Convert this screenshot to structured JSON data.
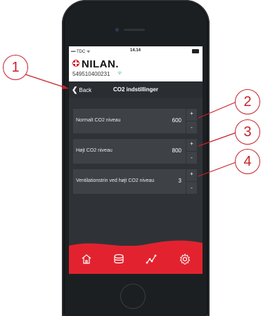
{
  "status_bar": {
    "carrier": "TDC",
    "time": "14.14"
  },
  "brand": {
    "logo_text": "NILAN.",
    "serial": "549510400231"
  },
  "nav": {
    "back_label": "Back",
    "title": "CO2 indstillinger"
  },
  "settings": [
    {
      "label": "Normalt CO2 niveau",
      "value": "600",
      "plus": "+",
      "minus": "-"
    },
    {
      "label": "Højt CO2 niveau",
      "value": "800",
      "plus": "+",
      "minus": "-"
    },
    {
      "label": "Ventilationstrin ved højt CO2 niveau",
      "value": "3",
      "plus": "+",
      "minus": "-"
    }
  ],
  "footer_icons": [
    "home-icon",
    "layers-icon",
    "graph-icon",
    "gear-icon"
  ],
  "callouts": [
    "1",
    "2",
    "3",
    "4"
  ],
  "colors": {
    "accent": "#e2232f",
    "callout": "#c8222b",
    "screen_bg": "#2f3337",
    "row_bg": "#3e4246"
  }
}
